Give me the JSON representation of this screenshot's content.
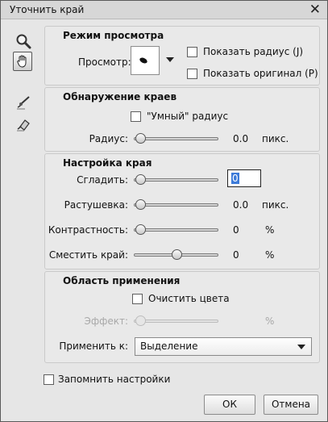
{
  "window": {
    "title": "Уточнить край"
  },
  "tools": [
    {
      "name": "zoom"
    },
    {
      "name": "hand"
    },
    {
      "name": "refine-radius-brush"
    },
    {
      "name": "erase-refinements-brush"
    }
  ],
  "view_mode": {
    "title": "Режим просмотра",
    "view_label": "Просмотр:",
    "show_radius": "Показать радиус (J)",
    "show_original": "Показать оригинал (P)"
  },
  "edge_detection": {
    "title": "Обнаружение краев",
    "smart_radius": "\"Умный\" радиус",
    "radius_label": "Радиус:",
    "radius_value": "0.0",
    "radius_unit": "пикс.",
    "radius_fraction": 0
  },
  "adjust_edge": {
    "title": "Настройка края",
    "smooth_label": "Сгладить:",
    "smooth_value": "0",
    "smooth_fraction": 0,
    "feather_label": "Растушевка:",
    "feather_value": "0.0",
    "feather_unit": "пикс.",
    "feather_fraction": 0,
    "contrast_label": "Контрастность:",
    "contrast_value": "0",
    "contrast_unit": "%",
    "contrast_fraction": 0,
    "shift_label": "Сместить край:",
    "shift_value": "0",
    "shift_unit": "%",
    "shift_fraction": 0.5
  },
  "output": {
    "title": "Область применения",
    "decontaminate": "Очистить цвета",
    "effect_label": "Эффект:",
    "effect_unit": "%",
    "effect_fraction": 0,
    "output_label": "Применить к:",
    "output_value": "Выделение"
  },
  "remember": "Запомнить настройки",
  "buttons": {
    "ok": "ОК",
    "cancel": "Отмена"
  }
}
